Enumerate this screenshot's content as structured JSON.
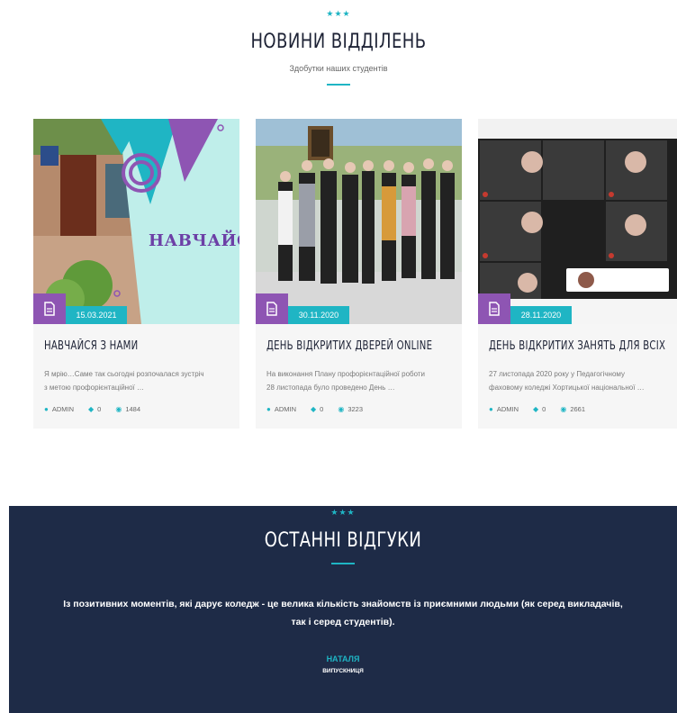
{
  "news_section": {
    "stars": "★★★",
    "title": "НОВИНИ ВІДДІЛЕНЬ",
    "subtitle": "Здобутки наших студентів"
  },
  "cards": [
    {
      "image_text": "НАВЧАЙС",
      "date": "15.03.2021",
      "title": "НАВЧАЙСЯ З НАМИ",
      "excerpt_line1": "Я мрію…Саме так сьогодні розпочалася зустріч",
      "excerpt_line2": "з метою профорієнтаційної …",
      "author": "ADMIN",
      "comments": "0",
      "views": "1484"
    },
    {
      "date": "30.11.2020",
      "title": "ДЕНЬ ВІДКРИТИХ ДВЕРЕЙ ONLINE",
      "excerpt_line1": "На виконання Плану профорієнтаційної роботи",
      "excerpt_line2": "28 листопада було проведено День …",
      "author": "ADMIN",
      "comments": "0",
      "views": "3223"
    },
    {
      "date": "28.11.2020",
      "title": "ДЕНЬ ВІДКРИТИХ ЗАНЯТЬ ДЛЯ ВСІХ",
      "excerpt_line1": "27 листопада 2020 року у Педагогічному",
      "excerpt_line2": "фаховому коледжі Хортицької національної …",
      "author": "ADMIN",
      "comments": "0",
      "views": "2661"
    }
  ],
  "reviews_section": {
    "stars": "★★★",
    "title": "ОСТАННІ ВІДГУКИ",
    "quote": "Із позитивних моментів, які дарує коледж - це велика кількість знайомств із приємними людьми (як серед викладачів, так і серед студентів).",
    "name": "НАТАЛЯ",
    "role": "ВИПУСКНИЦЯ"
  },
  "colors": {
    "accent": "#1fb5c4",
    "purple": "#8e55b3",
    "navy": "#1e2b47"
  },
  "icons": [
    "document-icon",
    "user-icon",
    "comment-icon",
    "eye-icon"
  ]
}
